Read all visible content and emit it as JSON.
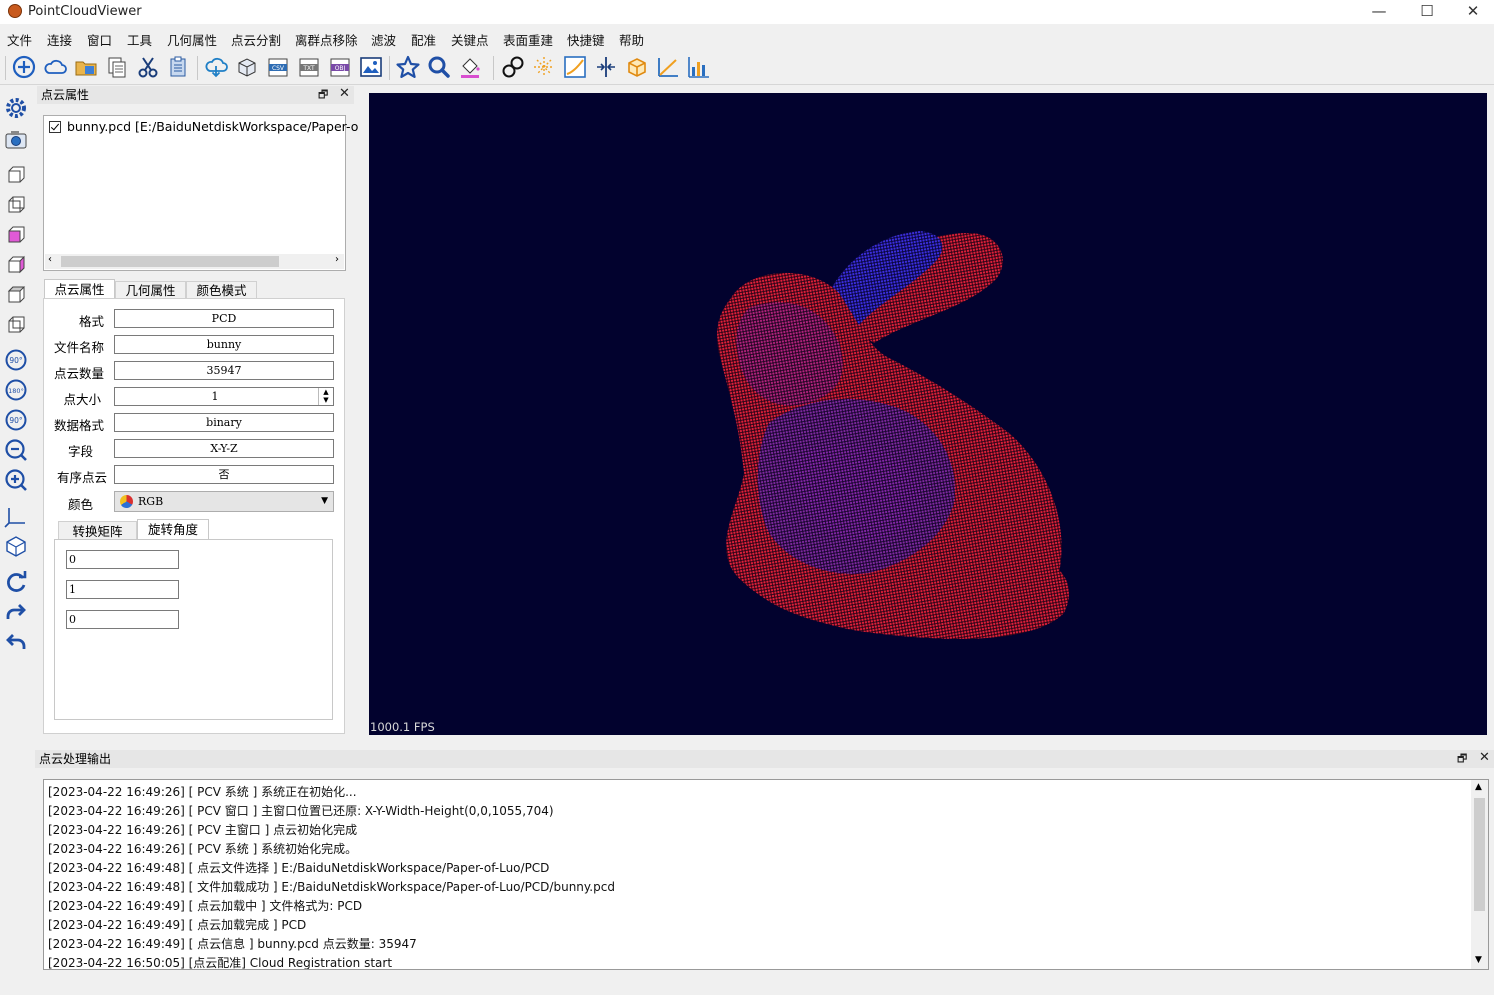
{
  "window": {
    "title": "PointCloudViewer",
    "minimize": "—",
    "maximize": "☐",
    "close": "✕"
  },
  "menu": [
    "文件",
    "连接",
    "窗口",
    "工具",
    "几何属性",
    "点云分割",
    "离群点移除",
    "滤波",
    "配准",
    "关键点",
    "表面重建",
    "快捷键",
    "帮助"
  ],
  "toolbar_icons": [
    "add-icon",
    "cloud-icon",
    "open-folder-icon",
    "copy-doc-icon",
    "cut-icon",
    "paste-icon",
    "cloud-download-icon",
    "box-3d-icon",
    "csv-icon",
    "txt-icon",
    "obj-icon",
    "image-icon",
    "star-icon",
    "search-icon",
    "paint-bucket-icon",
    "link-icon",
    "sparkle-icon",
    "curve-icon",
    "split-icon",
    "cube-icon",
    "axis-icon",
    "bar-chart-icon"
  ],
  "left_toolbar_icons": [
    "settings-icon",
    "camera-icon",
    "view-front-icon",
    "view-back-icon",
    "view-left-icon",
    "view-right-icon",
    "view-top-icon",
    "view-bottom-icon",
    "rotate-90-icon",
    "rotate-180-icon",
    "rotate-minus-90-icon",
    "zoom-out-icon",
    "zoom-in-icon",
    "axes-icon",
    "iso-view-icon",
    "refresh-icon",
    "redo-icon",
    "undo-icon"
  ],
  "left_toolbar_texts": {
    "rotate_90": "90°",
    "rotate_180": "180°",
    "rotate_minus_90": "90°"
  },
  "props_panel": {
    "title": "点云属性",
    "files": [
      {
        "name": "bunny.pcd [E:/BaiduNetdiskWorkspace/Paper-o",
        "checked": true
      }
    ],
    "tabs": [
      "点云属性",
      "几何属性",
      "颜色模式"
    ],
    "active_tab": 0,
    "fields": [
      {
        "label": "格式",
        "value": "PCD"
      },
      {
        "label": "文件名称",
        "value": "bunny"
      },
      {
        "label": "点云数量",
        "value": "35947"
      },
      {
        "label": "点大小",
        "value": "1"
      },
      {
        "label": "数据格式",
        "value": "binary"
      },
      {
        "label": "字段",
        "value": "X-Y-Z"
      },
      {
        "label": "有序点云",
        "value": "否"
      }
    ],
    "color_label": "颜色",
    "color_value": "RGB",
    "sub_tabs": [
      "转换矩阵",
      "旋转角度"
    ],
    "active_sub_tab": 1,
    "rotation_values": [
      "0",
      "1",
      "0"
    ]
  },
  "viewer": {
    "fps": "1000.1 FPS",
    "background": "#02022e",
    "colors": [
      "#d81e2e",
      "#3a2bd8"
    ]
  },
  "output_panel": {
    "title": "点云处理输出",
    "lines": [
      "[2023-04-22 16:49:26]  [ PCV 系统 ] 系统正在初始化...",
      "[2023-04-22 16:49:26]  [ PCV 窗口 ] 主窗口位置已还原: X-Y-Width-Height(0,0,1055,704)",
      "[2023-04-22 16:49:26]  [ PCV 主窗口 ] 点云初始化完成",
      "[2023-04-22 16:49:26]  [ PCV 系统 ] 系统初始化完成。",
      "[2023-04-22 16:49:48]  [ 点云文件选择 ] E:/BaiduNetdiskWorkspace/Paper-of-Luo/PCD",
      "[2023-04-22 16:49:48]  [ 文件加载成功 ] E:/BaiduNetdiskWorkspace/Paper-of-Luo/PCD/bunny.pcd",
      "[2023-04-22 16:49:49]  [ 点云加载中 ] 文件格式为:  PCD",
      "[2023-04-22 16:49:49]  [ 点云加载完成 ] PCD",
      "[2023-04-22 16:49:49]  [ 点云信息 ] bunny.pcd 点云数量: 35947",
      "[2023-04-22 16:50:05] [点云配准] Cloud Registration start"
    ]
  },
  "dock_buttons": {
    "float": "🗗",
    "close": "✕"
  }
}
